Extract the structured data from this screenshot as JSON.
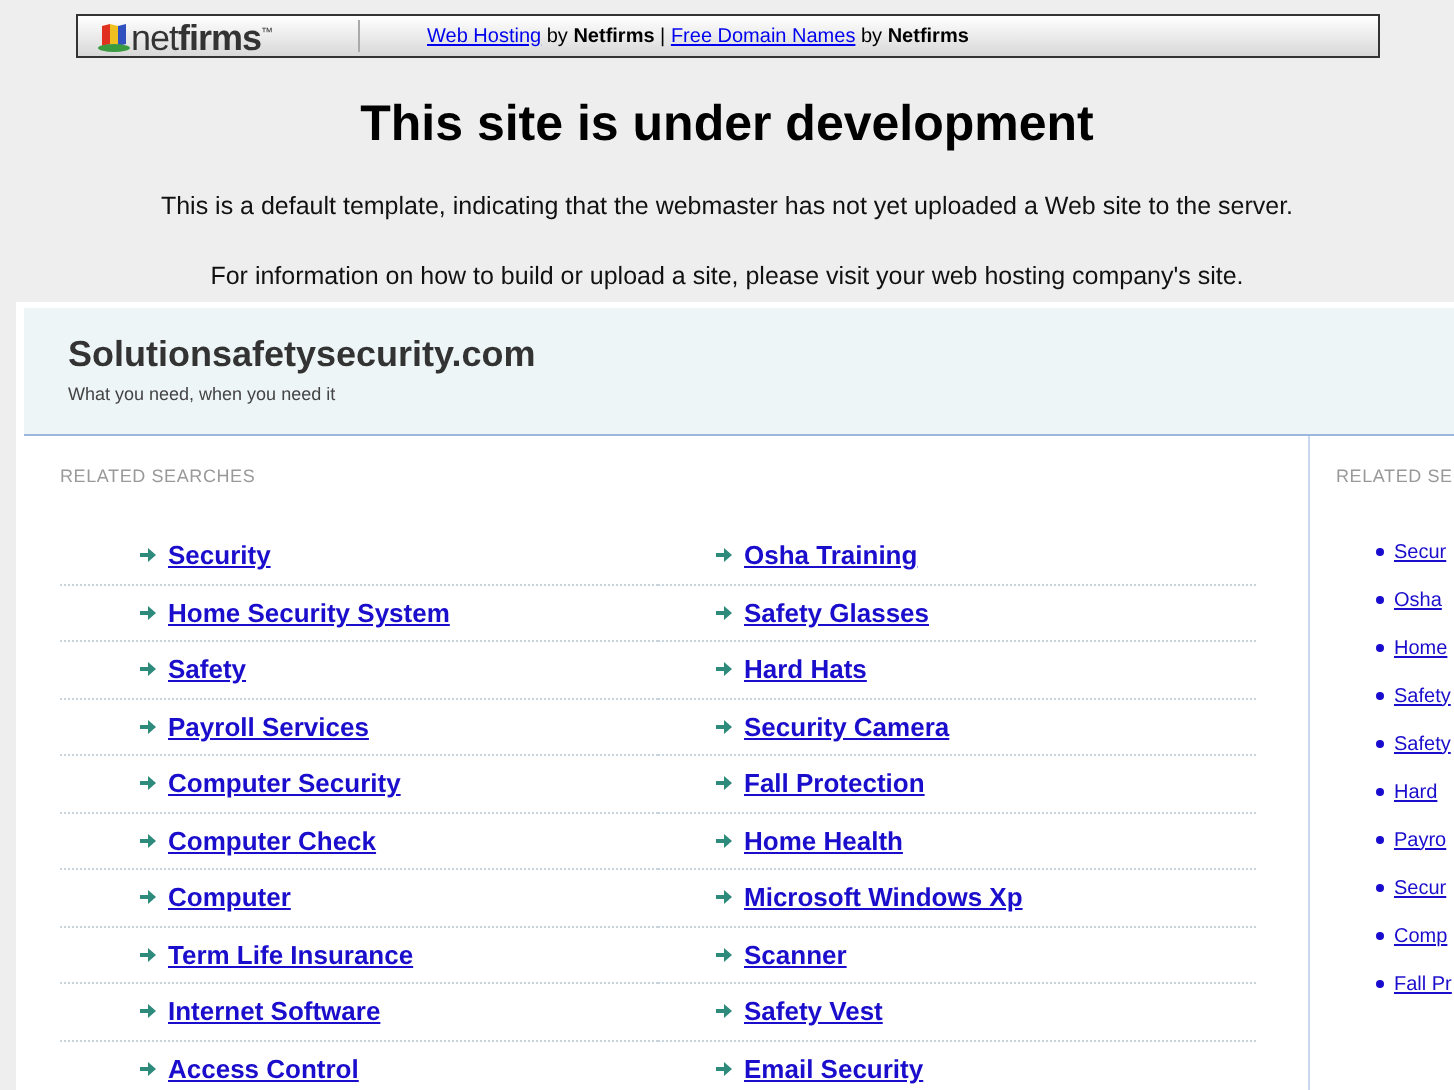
{
  "banner": {
    "logo": "net**firms**$^{™}$",
    "links": [
      {
        "kind": "link",
        "text": "Web Hosting"
      },
      {
        "kind": "plain",
        "text": " by "
      },
      {
        "kind": "bold",
        "text": "Netfirms"
      },
      {
        "kind": "plain",
        "text": " | "
      },
      {
        "kind": "link",
        "text": "Free Domain Names"
      },
      {
        "kind": "plain",
        "text": " by "
      },
      {
        "kind": "bold",
        "text": "Netfirms"
      }
    ]
  },
  "title": "This site is under development",
  "paragraphs": [
    "This is a default template, indicating that the webmaster has not yet uploaded a Web site to the server.",
    "For information on how to build or upload a site, please visit your web hosting company's site."
  ],
  "site": {
    "name": "Solutionsafetysecurity.com",
    "tagline": "What you need, when you need it"
  },
  "main": {
    "heading": "RELATED SEARCHES",
    "columns": [
      [
        "Security",
        "Home Security System",
        "Safety",
        "Payroll Services",
        "Computer Security",
        "Computer Check",
        "Computer",
        "Term Life Insurance",
        "Internet Software",
        "Access Control"
      ],
      [
        "Osha Training",
        "Safety Glasses",
        "Hard Hats",
        "Security Camera",
        "Fall Protection",
        "Home Health",
        "Microsoft Windows Xp",
        "Scanner",
        "Safety Vest",
        "Email Security"
      ]
    ]
  },
  "sidebar": {
    "heading": "RELATED SE",
    "items": [
      "Secur",
      "Osha",
      "Home",
      "Safety",
      "Safety",
      "Hard",
      "Payro",
      "Secur",
      "Comp",
      "Fall Pr"
    ]
  }
}
